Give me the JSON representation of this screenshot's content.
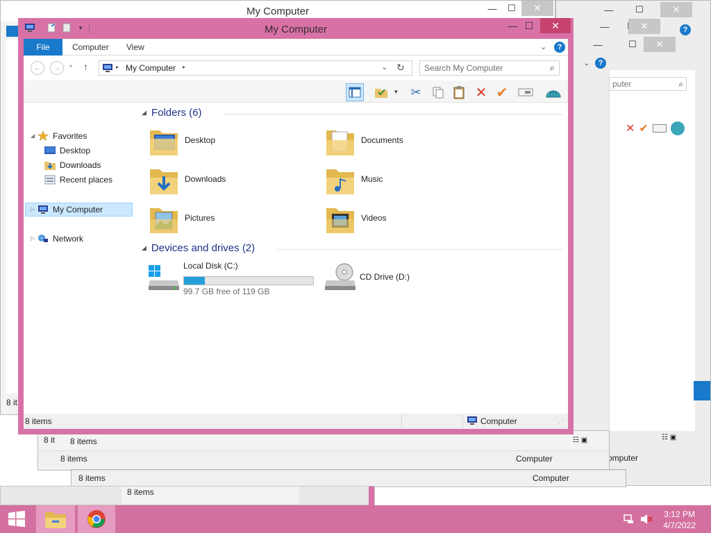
{
  "window": {
    "title": "My Computer",
    "minimize": "—",
    "maximize": "☐",
    "close": "✕"
  },
  "ribbon": {
    "tabs": [
      "File",
      "Computer",
      "View"
    ]
  },
  "address": {
    "path": "My Computer",
    "search_placeholder": "Search My Computer"
  },
  "nav": {
    "favorites": "Favorites",
    "desktop": "Desktop",
    "downloads": "Downloads",
    "recent": "Recent places",
    "computer": "My Computer",
    "network": "Network"
  },
  "content": {
    "folders_header": "Folders (6)",
    "folders": [
      "Desktop",
      "Documents",
      "Downloads",
      "Music",
      "Pictures",
      "Videos"
    ],
    "drives_header": "Devices and drives (2)",
    "drive_c": {
      "label": "Local Disk (C:)",
      "free_text": "99.7 GB free of 119 GB",
      "used_fraction": 0.16
    },
    "drive_d": {
      "label": "CD Drive (D:)"
    }
  },
  "status": {
    "items": "8 items",
    "location": "Computer"
  },
  "background_windows": {
    "title": "My Computer",
    "items": "8 items",
    "partial_items": "8 it",
    "location": "Computer",
    "partial_location": "omputer",
    "partial_search": "puter"
  },
  "taskbar": {
    "time": "3:12 PM",
    "date": "4/7/2022"
  },
  "colors": {
    "accent_frame": "#d872a6",
    "taskbar": "#d4709f",
    "file_tab": "#1979ca",
    "close_button": "#c7436e",
    "drive_bar": "#26a0da",
    "group_header": "#1e3287",
    "selection": "#cce8ff"
  }
}
